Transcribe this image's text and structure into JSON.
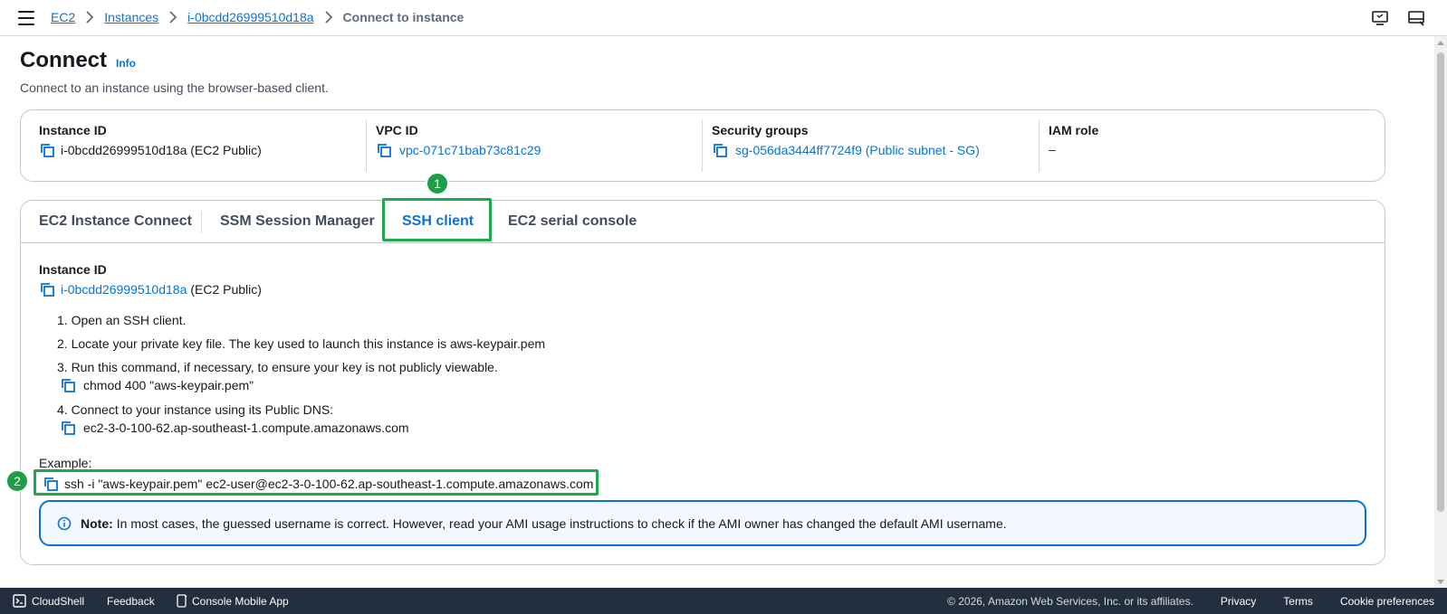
{
  "breadcrumb": {
    "items": [
      "EC2",
      "Instances",
      "i-0bcdd26999510d18a"
    ],
    "current": "Connect to instance"
  },
  "header": {
    "title": "Connect",
    "info_label": "Info",
    "description": "Connect to an instance using the browser-based client."
  },
  "details": {
    "instance_id": {
      "label": "Instance ID",
      "value": "i-0bcdd26999510d18a (EC2 Public)"
    },
    "vpc_id": {
      "label": "VPC ID",
      "value": "vpc-071c71bab73c81c29"
    },
    "security_groups": {
      "label": "Security groups",
      "value": "sg-056da3444ff7724f9 (Public subnet - SG)"
    },
    "iam_role": {
      "label": "IAM role",
      "value": "–"
    }
  },
  "tabs": [
    {
      "label": "EC2 Instance Connect",
      "active": false
    },
    {
      "label": "SSM Session Manager",
      "active": false
    },
    {
      "label": "SSH client",
      "active": true
    },
    {
      "label": "EC2 serial console",
      "active": false
    }
  ],
  "badges": {
    "one": "1",
    "two": "2"
  },
  "ssh": {
    "instance_label": "Instance ID",
    "instance_link": "i-0bcdd26999510d18a",
    "instance_suffix": "(EC2 Public)",
    "steps": [
      "1. Open an SSH client.",
      "2. Locate your private key file. The key used to launch this instance is aws-keypair.pem",
      "3. Run this command, if necessary, to ensure your key is not publicly viewable.",
      "4. Connect to your instance using its Public DNS:"
    ],
    "chmod_cmd": "chmod 400 \"aws-keypair.pem\"",
    "public_dns": "ec2-3-0-100-62.ap-southeast-1.compute.amazonaws.com",
    "example_label": "Example:",
    "example_cmd": "ssh -i \"aws-keypair.pem\" ec2-user@ec2-3-0-100-62.ap-southeast-1.compute.amazonaws.com",
    "note_label": "Note:",
    "note_text": "In most cases, the guessed username is correct. However, read your AMI usage instructions to check if the AMI owner has changed the default AMI username."
  },
  "footer": {
    "cloudshell": "CloudShell",
    "feedback": "Feedback",
    "mobile_app": "Console Mobile App",
    "copyright": "© 2026, Amazon Web Services, Inc. or its affiliates.",
    "privacy": "Privacy",
    "terms": "Terms",
    "cookies": "Cookie preferences"
  },
  "colors": {
    "link": "#0972d3",
    "highlight": "#1fa84a",
    "footer_bg": "#232f3e"
  }
}
